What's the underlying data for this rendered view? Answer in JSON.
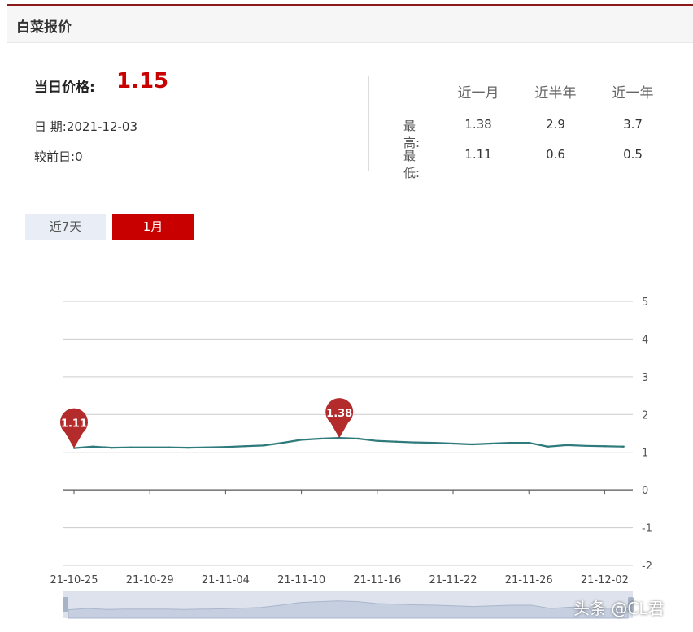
{
  "header": {
    "title": "白菜报价"
  },
  "summary": {
    "price_label": "当日价格:",
    "price_value": "1.15",
    "date_label": "日 期:",
    "date_value": "2021-12-03",
    "change_label": "较前日:",
    "change_value": "0"
  },
  "stats": {
    "columns": [
      "近一月",
      "近半年",
      "近一年"
    ],
    "rows": [
      {
        "label": "最高:",
        "values": [
          "1.38",
          "2.9",
          "3.7"
        ]
      },
      {
        "label": "最低:",
        "values": [
          "1.11",
          "0.6",
          "0.5"
        ]
      }
    ]
  },
  "range_buttons": {
    "week": "近7天",
    "month": "1月",
    "active": "month"
  },
  "colors": {
    "accent": "#c80000",
    "line": "#2f7a7a",
    "marker": "#b32b2b",
    "grid": "#cccccc"
  },
  "watermark": "头条 @CL君",
  "chart_data": {
    "type": "line",
    "x_tick_labels": [
      "21-10-25",
      "21-10-29",
      "21-11-04",
      "21-11-10",
      "21-11-16",
      "21-11-22",
      "21-11-26",
      "21-12-02"
    ],
    "x_tick_indices": [
      0,
      4,
      8,
      12,
      16,
      20,
      24,
      28
    ],
    "y_ticks": [
      5,
      4,
      3,
      2,
      1,
      0,
      -1,
      -2
    ],
    "ylim": [
      -2,
      5
    ],
    "grid": true,
    "series": [
      {
        "values": [
          1.11,
          1.15,
          1.12,
          1.13,
          1.13,
          1.13,
          1.12,
          1.13,
          1.14,
          1.16,
          1.18,
          1.25,
          1.33,
          1.36,
          1.38,
          1.36,
          1.3,
          1.28,
          1.26,
          1.25,
          1.23,
          1.21,
          1.23,
          1.25,
          1.25,
          1.15,
          1.19,
          1.17,
          1.16,
          1.15
        ]
      }
    ],
    "markers": [
      {
        "label": "1.11",
        "index": 0,
        "value": 1.11
      },
      {
        "label": "1.38",
        "index": 14,
        "value": 1.38
      }
    ]
  }
}
